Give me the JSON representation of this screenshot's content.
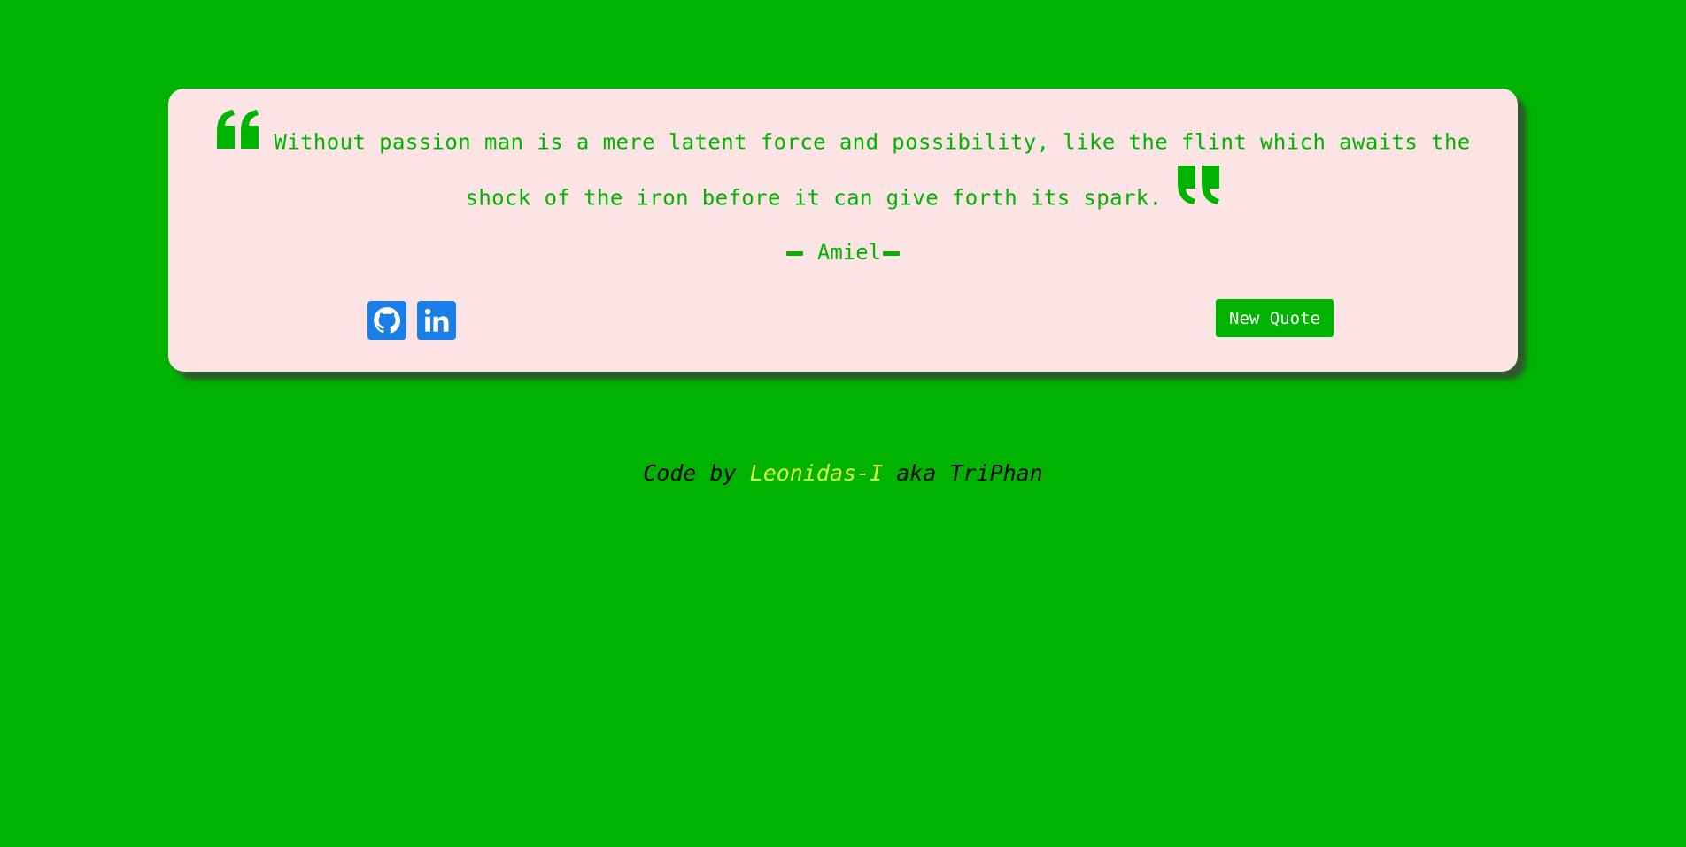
{
  "quote": {
    "text": "Without passion man is a mere latent force and possibility, like the flint which awaits the shock of the iron before it can give forth its spark.",
    "author": "Amiel",
    "open_icon": "quote-left-icon",
    "close_icon": "quote-right-icon"
  },
  "social": {
    "github_icon": "github-icon",
    "linkedin_icon": "linkedin-icon"
  },
  "actions": {
    "new_quote_label": "New Quote"
  },
  "footer": {
    "prefix": "Code by ",
    "author_link": "Leonidas-I",
    "suffix": " aka TriPhan"
  },
  "colors": {
    "background": "#00b300",
    "card": "#fde4e4",
    "accent": "#00b300",
    "social_blue": "#1a7ee8",
    "link": "#d9ff3a"
  }
}
